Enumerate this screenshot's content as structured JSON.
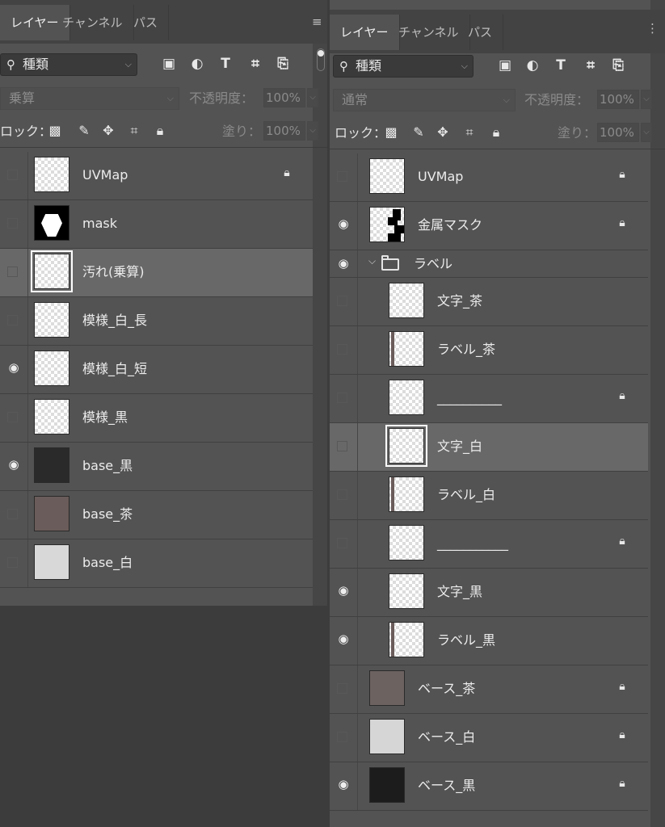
{
  "left_panel": {
    "tabs": [
      {
        "label": "レイヤー",
        "active": true
      },
      {
        "label": "チャンネル"
      },
      {
        "label": "パス"
      }
    ],
    "search": {
      "icon": "search-icon",
      "value": "種類"
    },
    "filter_icons": [
      "image-filter-icon",
      "adjustment-filter-icon",
      "type-filter-icon",
      "shape-filter-icon",
      "smart-object-filter-icon"
    ],
    "blend_mode": "乗算",
    "opacity_label": "不透明度：",
    "opacity_value": "100%",
    "lock_label": "ロック：",
    "lock_icons": [
      "lock-transparent-icon",
      "lock-image-icon",
      "lock-position-icon",
      "lock-artboard-icon",
      "lock-all-icon"
    ],
    "fill_label": "塗り：",
    "fill_value": "100%",
    "layers": [
      {
        "name": "UVMap",
        "visible": false,
        "locked": true,
        "thumb": "checker"
      },
      {
        "name": "mask",
        "visible": false,
        "locked": false,
        "thumb": "mask"
      },
      {
        "name": "汚れ(乗算)",
        "visible": false,
        "locked": false,
        "thumb": "checker",
        "selected": true
      },
      {
        "name": "模様_白_長",
        "visible": false,
        "locked": false,
        "thumb": "checker"
      },
      {
        "name": "模様_白_短",
        "visible": true,
        "locked": false,
        "thumb": "checker"
      },
      {
        "name": "模様_黒",
        "visible": false,
        "locked": false,
        "thumb": "checker"
      },
      {
        "name": "base_黒",
        "visible": true,
        "locked": false,
        "thumb": "#2a2a2a"
      },
      {
        "name": "base_茶",
        "visible": false,
        "locked": false,
        "thumb": "#6a5c5a"
      },
      {
        "name": "base_白",
        "visible": false,
        "locked": false,
        "thumb": "#d8d8d8"
      }
    ]
  },
  "right_panel": {
    "tabs": [
      {
        "label": "レイヤー",
        "active": true
      },
      {
        "label": "チャンネル"
      },
      {
        "label": "パス"
      }
    ],
    "search": {
      "icon": "search-icon",
      "value": "種類"
    },
    "blend_mode": "通常",
    "opacity_label": "不透明度：",
    "opacity_value": "100%",
    "lock_label": "ロック：",
    "fill_label": "塗り：",
    "fill_value": "100%",
    "layers": [
      {
        "name": "UVMap",
        "visible": false,
        "locked": true,
        "thumb": "checker",
        "indent": 0
      },
      {
        "name": "金属マスク",
        "visible": true,
        "locked": true,
        "thumb": "metal",
        "indent": 0
      },
      {
        "name": "ラベル",
        "group": true,
        "visible": true
      },
      {
        "name": "文字_茶",
        "visible": false,
        "locked": false,
        "thumb": "checker",
        "indent": 1
      },
      {
        "name": "ラベル_茶",
        "visible": false,
        "locked": false,
        "thumb": "label",
        "indent": 1
      },
      {
        "name": "__________",
        "visible": false,
        "locked": true,
        "thumb": "checker",
        "indent": 1
      },
      {
        "name": "文字_白",
        "visible": false,
        "locked": false,
        "thumb": "checker",
        "indent": 1,
        "selected": true
      },
      {
        "name": "ラベル_白",
        "visible": false,
        "locked": false,
        "thumb": "label",
        "indent": 1
      },
      {
        "name": "___________",
        "visible": false,
        "locked": true,
        "thumb": "checker",
        "indent": 1
      },
      {
        "name": "文字_黒",
        "visible": true,
        "locked": false,
        "thumb": "checker",
        "indent": 1
      },
      {
        "name": "ラベル_黒",
        "visible": true,
        "locked": false,
        "thumb": "label",
        "indent": 1
      },
      {
        "name": "ベース_茶",
        "visible": false,
        "locked": true,
        "thumb": "#6c6361",
        "indent": 0
      },
      {
        "name": "ベース_白",
        "visible": false,
        "locked": true,
        "thumb": "#d6d6d6",
        "indent": 0
      },
      {
        "name": "ベース_黒",
        "visible": true,
        "locked": true,
        "thumb": "#1c1c1c",
        "indent": 0
      }
    ]
  }
}
